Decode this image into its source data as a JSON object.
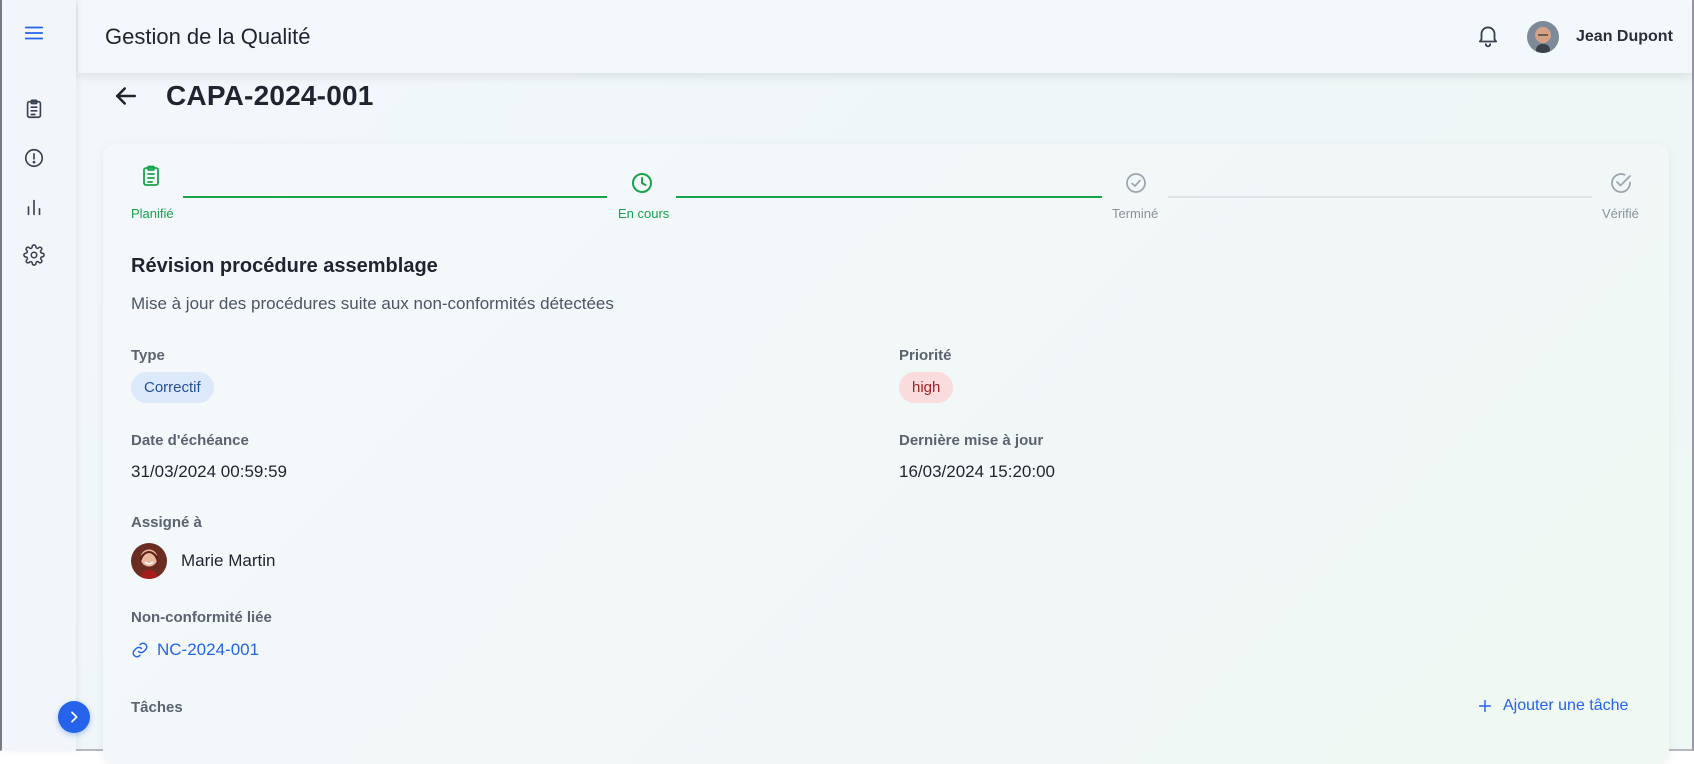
{
  "header": {
    "title": "Gestion de la Qualité",
    "user_name": "Jean Dupont"
  },
  "sidebar": {
    "items": [
      {
        "icon": "menu-icon"
      },
      {
        "icon": "clipboard-icon"
      },
      {
        "icon": "alert-circle-icon"
      },
      {
        "icon": "bar-chart-icon"
      },
      {
        "icon": "gear-icon"
      }
    ]
  },
  "page": {
    "title": "CAPA-2024-001"
  },
  "stepper": {
    "steps": [
      {
        "label": "Planifié",
        "state": "done",
        "icon": "clipboard-check-icon"
      },
      {
        "label": "En cours",
        "state": "active",
        "icon": "clock-icon"
      },
      {
        "label": "Terminé",
        "state": "pending",
        "icon": "check-circle-icon"
      },
      {
        "label": "Vérifié",
        "state": "pending",
        "icon": "check-badge-icon"
      }
    ]
  },
  "detail": {
    "title": "Révision procédure assemblage",
    "description": "Mise à jour des procédures suite aux non-conformités détectées",
    "type_label": "Type",
    "type_value": "Correctif",
    "priority_label": "Priorité",
    "priority_value": "high",
    "due_label": "Date d'échéance",
    "due_value": "31/03/2024 00:59:59",
    "updated_label": "Dernière mise à jour",
    "updated_value": "16/03/2024 15:20:00",
    "assigned_label": "Assigné à",
    "assigned_value": "Marie Martin",
    "nc_label": "Non-conformité liée",
    "nc_value": "NC-2024-001",
    "tasks_label": "Tâches",
    "add_task_label": "Ajouter une tâche"
  },
  "colors": {
    "accent": "#2563eb",
    "success": "#16a34a",
    "pending": "#9ca3af",
    "chip_type_bg": "#dbe9fb",
    "chip_priority_bg": "#fbdcdc"
  }
}
